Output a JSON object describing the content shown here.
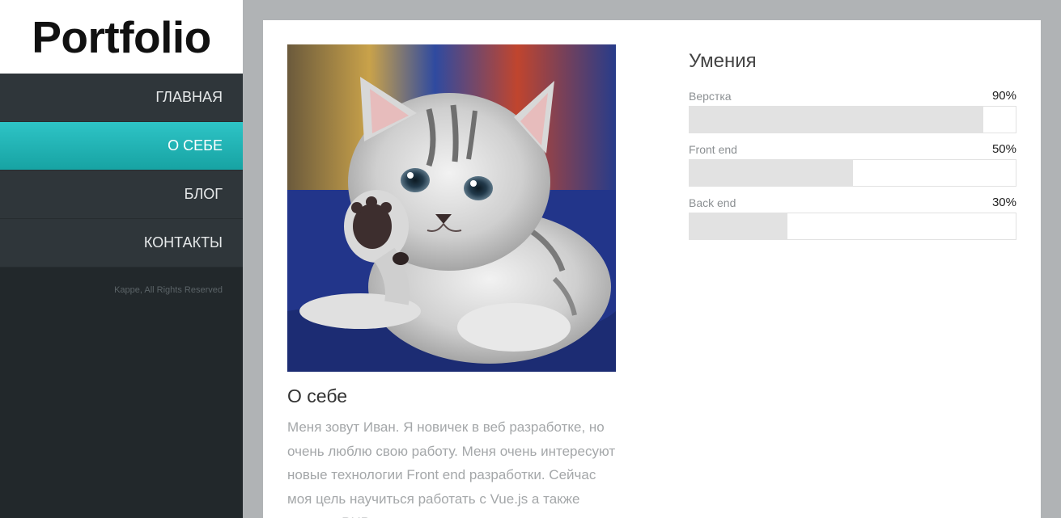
{
  "sidebar": {
    "logo": "Portfolio",
    "nav": [
      {
        "label": "ГЛАВНАЯ",
        "active": false
      },
      {
        "label": "О СЕБЕ",
        "active": true
      },
      {
        "label": "БЛОГ",
        "active": false
      },
      {
        "label": "КОНТАКТЫ",
        "active": false
      }
    ],
    "copyright": "Kappe, All Rights Reserved"
  },
  "about": {
    "title": "О себе",
    "text": "Меня зовут Иван. Я новичек в веб разработке, но очень люблю свою работу. Меня очень интересуют новые технологии Front end разработки. Сейчас моя цель научиться работать с Vue.js а также освоить PHP"
  },
  "skills": {
    "title": "Умения",
    "items": [
      {
        "name": "Верстка",
        "percent_label": "90%",
        "value": 90
      },
      {
        "name": "Front end",
        "percent_label": "50%",
        "value": 50
      },
      {
        "name": "Back end",
        "percent_label": "30%",
        "value": 30
      }
    ]
  },
  "colors": {
    "accent": "#1fb3b5",
    "sidebar_bg": "#22282b",
    "nav_bg": "#2f363a",
    "page_bg": "#b0b3b5",
    "bar_fill": "#e2e2e2"
  }
}
